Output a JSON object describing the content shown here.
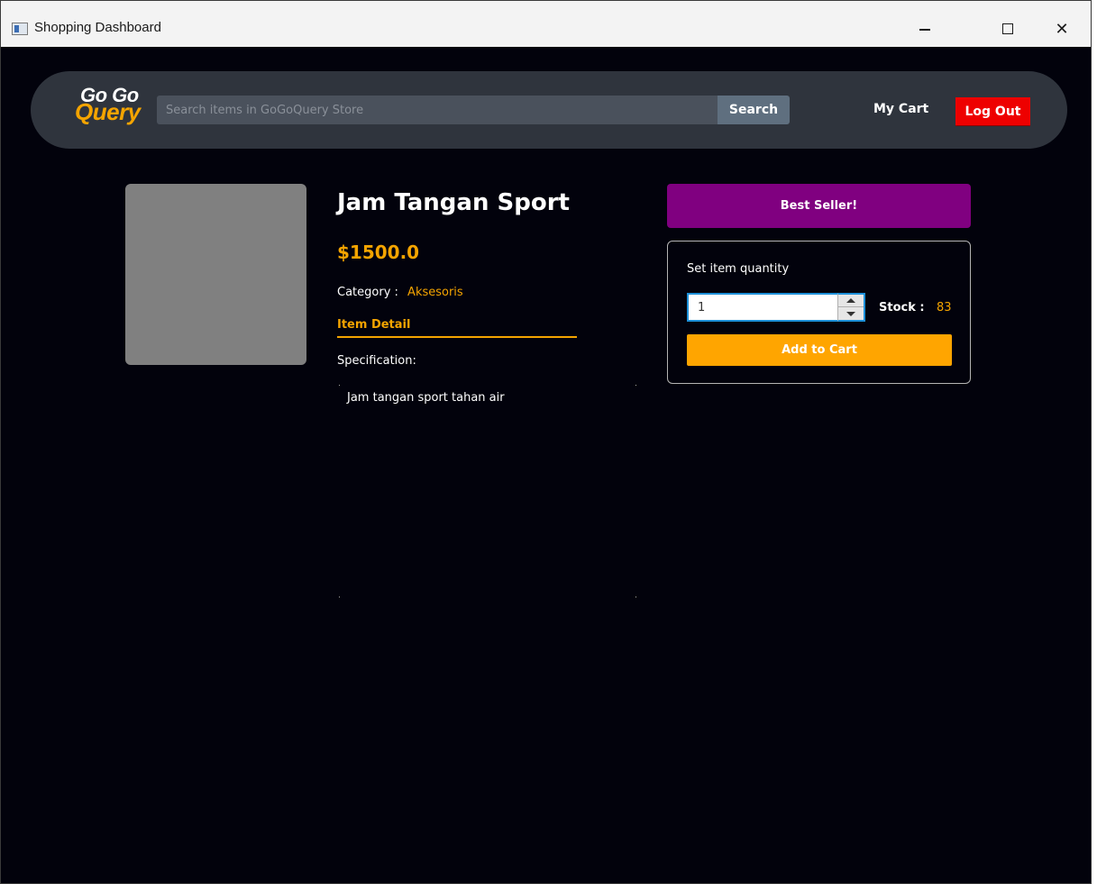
{
  "window": {
    "title": "Shopping Dashboard"
  },
  "navbar": {
    "logo_line1": "Go Go",
    "logo_line2": "Query",
    "search_placeholder": "Search items in GoGoQuery Store",
    "search_value": "",
    "search_button": "Search",
    "my_cart": "My Cart",
    "logout": "Log Out"
  },
  "product": {
    "name": "Jam Tangan Sport",
    "price": "$1500.0",
    "category_label": "Category :",
    "category_value": "Aksesoris",
    "detail_tab": "Item Detail",
    "spec_label": "Specification:",
    "spec_text": "Jam tangan sport tahan air"
  },
  "purchase": {
    "badge": "Best Seller!",
    "quantity_label": "Set item quantity",
    "quantity_value": "1",
    "stock_label": "Stock :",
    "stock_value": "83",
    "add_to_cart": "Add to Cart"
  },
  "colors": {
    "background": "#02020c",
    "navbar": "#2f343d",
    "accent": "#f4a400",
    "badge": "#800080",
    "logout": "#ee0000",
    "add_to_cart": "#ffa500"
  },
  "icons": {
    "app": "app-window-icon",
    "minimize": "minimize-icon",
    "maximize": "maximize-icon",
    "close": "close-icon",
    "spin_up": "chevron-up-icon",
    "spin_down": "chevron-down-icon"
  }
}
